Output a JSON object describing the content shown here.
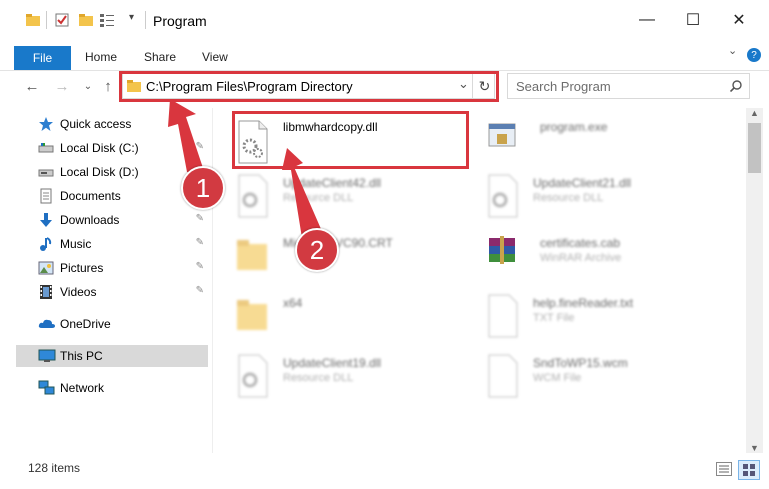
{
  "window": {
    "title": "Program",
    "minimize": "—",
    "maximize": "☐",
    "close": "✕"
  },
  "ribbon": {
    "tabs": [
      "File",
      "Home",
      "Share",
      "View"
    ],
    "help": "?"
  },
  "addressbar": {
    "path": "C:\\Program Files\\Program Directory",
    "dropdown": "⌄",
    "refresh": "↻"
  },
  "search": {
    "placeholder": "Search Program",
    "icon": "search-icon"
  },
  "sidebar": {
    "items": [
      {
        "label": "Quick access",
        "icon": "star-icon"
      },
      {
        "label": "Local Disk (C:)",
        "icon": "drive-icon",
        "pinned": true
      },
      {
        "label": "Local Disk (D:)",
        "icon": "drive-icon"
      },
      {
        "label": "Documents",
        "icon": "documents-icon"
      },
      {
        "label": "Downloads",
        "icon": "downloads-icon",
        "pinned": true
      },
      {
        "label": "Music",
        "icon": "music-icon",
        "pinned": true
      },
      {
        "label": "Pictures",
        "icon": "pictures-icon",
        "pinned": true
      },
      {
        "label": "Videos",
        "icon": "videos-icon",
        "pinned": true
      },
      {
        "label": "OneDrive",
        "icon": "cloud-icon"
      },
      {
        "label": "This PC",
        "icon": "pc-icon"
      },
      {
        "label": "Network",
        "icon": "network-icon"
      }
    ],
    "pin_glyph": "📌"
  },
  "files": [
    {
      "name": "libmwhardcopy.dll",
      "type": "",
      "icon": "dll-icon"
    },
    {
      "name": "program.exe",
      "type": "",
      "icon": "exe-icon"
    },
    {
      "name": "UpdateClient42.dll",
      "type": "Resource DLL",
      "icon": "dll-icon"
    },
    {
      "name": "UpdateClient21.dll",
      "type": "Resource DLL",
      "icon": "dll-icon"
    },
    {
      "name": "Microsoft.VC90.CRT",
      "type": "",
      "icon": "folder-icon"
    },
    {
      "name": "certificates.cab",
      "type": "WinRAR Archive",
      "icon": "archive-icon"
    },
    {
      "name": "x64",
      "type": "",
      "icon": "folder-icon"
    },
    {
      "name": "help.fineReader.txt",
      "type": "TXT File",
      "icon": "txt-icon"
    },
    {
      "name": "UpdateClient19.dll",
      "type": "Resource DLL",
      "icon": "dll-icon"
    },
    {
      "name": "SndToWP15.wcm",
      "type": "WCM File",
      "icon": "file-icon"
    }
  ],
  "status": {
    "count": "128 items"
  },
  "annotations": {
    "step1": "1",
    "step2": "2"
  },
  "colors": {
    "accent": "#1979ca",
    "annotation": "#d9363e"
  }
}
